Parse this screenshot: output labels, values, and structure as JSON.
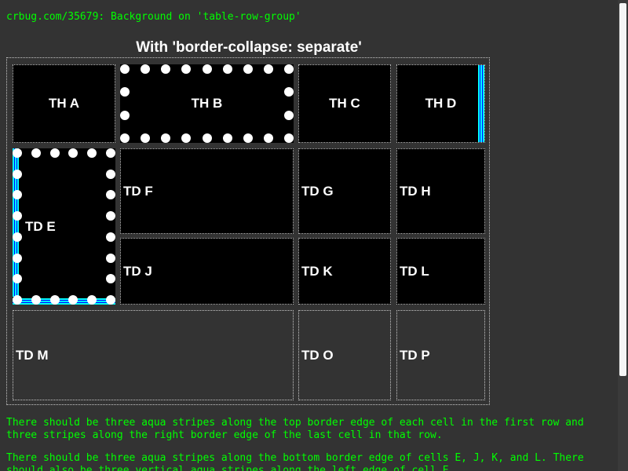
{
  "header": {
    "link_text": "crbug.com/35679: Background on 'table-row-group'"
  },
  "table": {
    "caption": "With 'border-collapse: separate'",
    "header_row": [
      "TH A",
      "TH B",
      "TH C",
      "TH D"
    ],
    "body_cells": {
      "e": "TD E",
      "f": "TD F",
      "g": "TD G",
      "h": "TD H",
      "j": "TD J",
      "k": "TD K",
      "l": "TD L"
    },
    "footer_cells": [
      "TD M",
      "TD O",
      "TD P"
    ]
  },
  "notes": [
    "There should be three aqua stripes along the top border edge of each cell in the first row and three stripes along the right border edge of the last cell in that row.",
    "There should be three aqua stripes along the bottom border edge of cells E, J, K, and L. There should also be three vertical aqua stripes along the left edge of cell E."
  ],
  "colors": {
    "background": "#333333",
    "text_green": "#00ff00",
    "stripe_aqua": "#00ffff",
    "stripe_blue": "#0000ff",
    "cell_black": "#000000"
  }
}
